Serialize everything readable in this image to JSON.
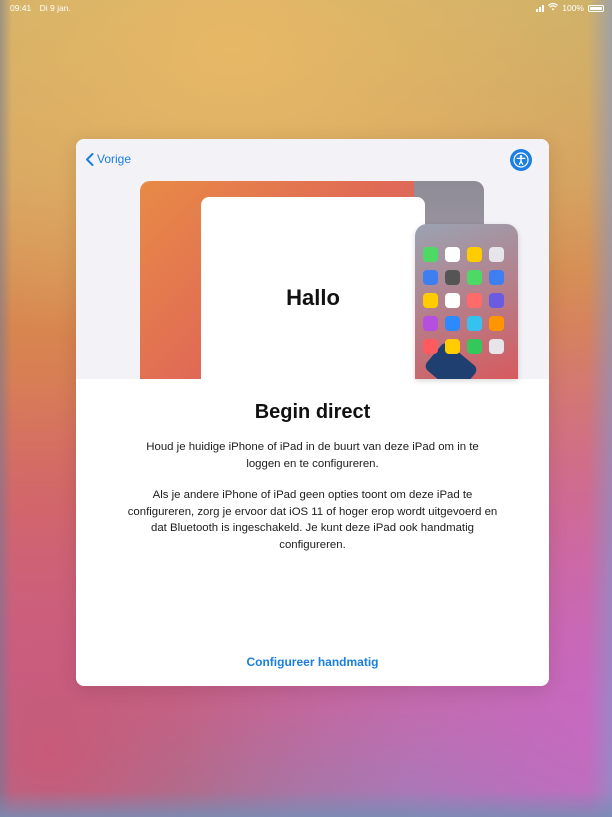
{
  "status_bar": {
    "time": "09:41",
    "date": "Di 9 jan.",
    "battery": "100%"
  },
  "setup_card": {
    "back_label": "Vorige",
    "accessibility_icon": "accessibility-icon",
    "illustration": {
      "hello_text": "Hallo",
      "app_icon_colors": [
        "#4cd964",
        "#ffffff",
        "#ffcc00",
        "#e5e5ea",
        "#3d7ff0",
        "#555555",
        "#4cd964",
        "#3d7ff0",
        "#ffcc00",
        "#ffffff",
        "#ff6b6b",
        "#6a5be0",
        "#b44fe0",
        "#2d89ff",
        "#34c3f0",
        "#ff9500",
        "#ff5a5f",
        "#ffcc00",
        "#34c759",
        "#e5e5ea"
      ]
    },
    "title": "Begin direct",
    "paragraph_1": "Houd je huidige iPhone of iPad in de buurt van deze iPad om in te loggen en te configureren.",
    "paragraph_2": "Als je andere iPhone of iPad geen opties toont om deze iPad te configureren, zorg je ervoor dat iOS 11 of hoger erop wordt uitgevoerd en dat Bluetooth is ingeschakeld. Je kunt deze iPad ook handmatig configureren.",
    "manual_setup_label": "Configureer handmatig",
    "accent_color": "#1a7fe0"
  }
}
